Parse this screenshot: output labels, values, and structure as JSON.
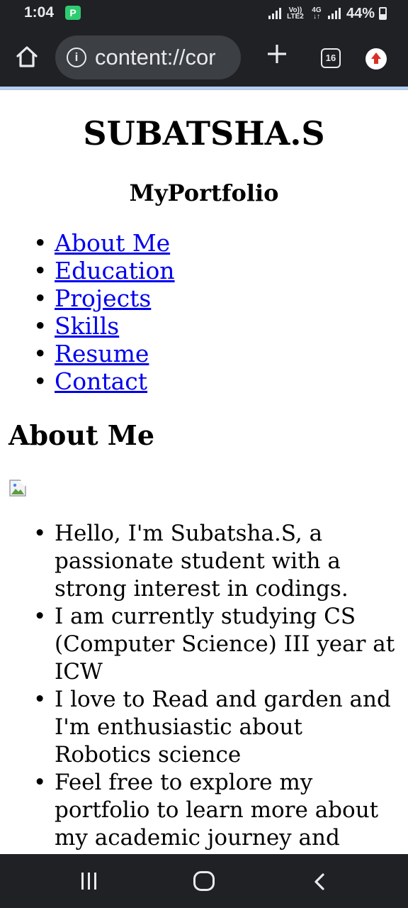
{
  "status_bar": {
    "time": "1:04",
    "app_icon": "P",
    "network_labels": [
      "Vo)) LTE2",
      "4G ↓↑"
    ],
    "battery": "44%"
  },
  "browser": {
    "url": "content://cor",
    "tab_count": "16",
    "icons": [
      "home-icon",
      "info-icon",
      "plus-icon",
      "tabs-icon",
      "update-icon"
    ]
  },
  "page": {
    "title": "SUBATSHA.S",
    "subtitle": "MyPortfolio",
    "nav": [
      {
        "label": "About Me"
      },
      {
        "label": "Education"
      },
      {
        "label": "Projects"
      },
      {
        "label": "Skills"
      },
      {
        "label": "Resume"
      },
      {
        "label": "Contact"
      }
    ],
    "section_heading": "About Me",
    "about_items": [
      "Hello, I'm Subatsha.S, a passionate student with a strong interest in codings.",
      "I am currently studying CS (Computer Science) III year at ICW",
      "I love to Read and garden and I'm enthusiastic about Robotics science",
      "Feel free to explore my portfolio to learn more about my academic journey and"
    ],
    "link_color": "#0000ee"
  },
  "system_nav": {
    "icons": [
      "recents-icon",
      "home-icon",
      "back-icon"
    ]
  }
}
